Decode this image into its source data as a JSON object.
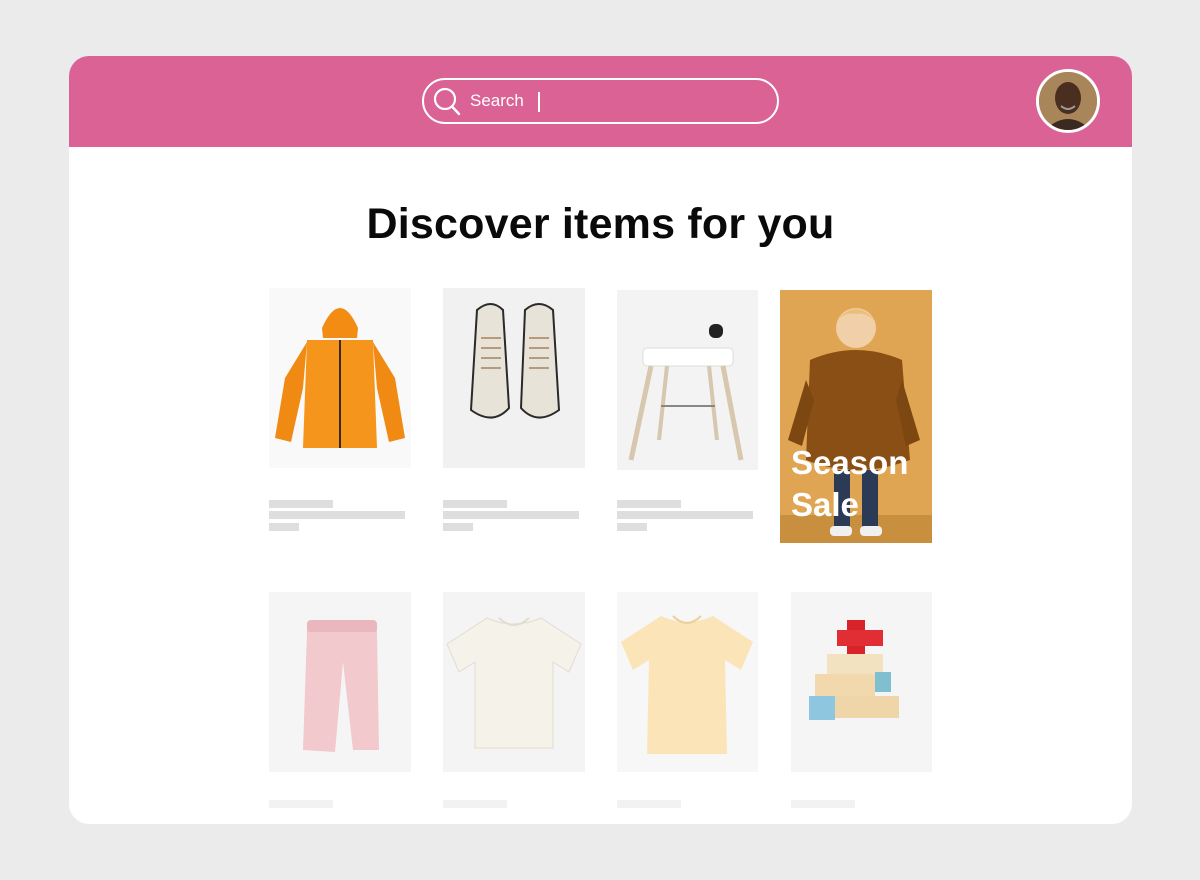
{
  "search": {
    "placeholder": "Search"
  },
  "page": {
    "heading": "Discover items for you"
  },
  "promo": {
    "text": "Season\nSale",
    "background": "#e0a552"
  },
  "products": [
    {
      "icon": "orange-hoodie-icon"
    },
    {
      "icon": "sneakers-icon"
    },
    {
      "icon": "baby-walker-chair-icon"
    },
    {
      "icon": "pink-pants-icon"
    },
    {
      "icon": "white-tshirt-icon"
    },
    {
      "icon": "yellow-tshirt-icon"
    },
    {
      "icon": "toy-blocks-icon"
    }
  ],
  "colors": {
    "header": "#da6295",
    "background": "#ebebeb",
    "placeholder": "#dedede"
  }
}
